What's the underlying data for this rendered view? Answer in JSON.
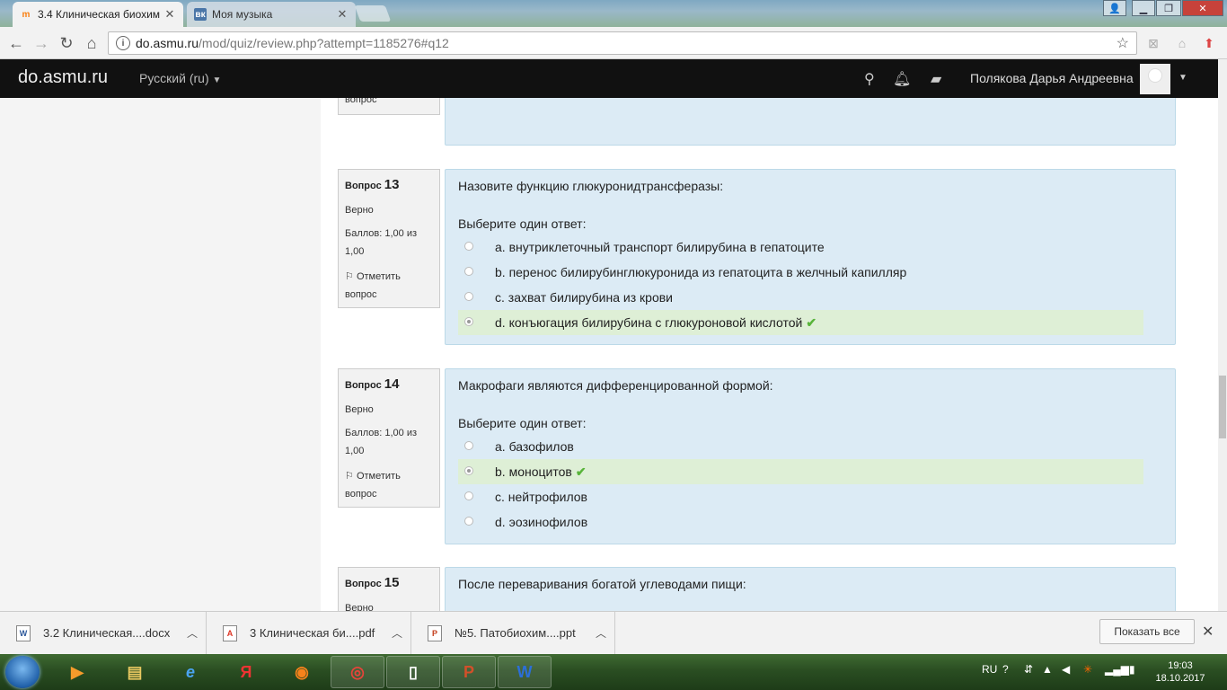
{
  "browser": {
    "tabs": [
      {
        "label": "3.4 Клиническая биохим",
        "active": true,
        "icon": "moodle-icon"
      },
      {
        "label": "Моя музыка",
        "active": false,
        "icon": "vk-icon"
      }
    ],
    "url_domain": "do.asmu.ru",
    "url_path": "/mod/quiz/review.php?attempt=1185276#q12"
  },
  "navbar": {
    "site_name": "do.asmu.ru",
    "language": "Русский (ru)",
    "user_name": "Полякова Дарья Андреевна"
  },
  "quiz": {
    "prev_block": {
      "flag_tail": "вопрос"
    },
    "questions": [
      {
        "label": "Вопрос",
        "number": "13",
        "state": "Верно",
        "grade": "Баллов: 1,00 из 1,00",
        "flag": "Отметить вопрос",
        "text": "Назовите функцию глюкуронидтрансферазы:",
        "prompt": "Выберите один ответ:",
        "options": [
          {
            "text": "a. внутриклеточный транспорт билирубина в гепатоците",
            "selected": false,
            "correct": false
          },
          {
            "text": "b. перенос билирубинглюкуронида из гепатоцита в желчный капилляр",
            "selected": false,
            "correct": false
          },
          {
            "text": "c. захват билирубина из крови",
            "selected": false,
            "correct": false
          },
          {
            "text": "d. конъюгация билирубина с глюкуроновой кислотой",
            "selected": true,
            "correct": true
          }
        ]
      },
      {
        "label": "Вопрос",
        "number": "14",
        "state": "Верно",
        "grade": "Баллов: 1,00 из 1,00",
        "flag": "Отметить вопрос",
        "text": "Макрофаги являются дифференцированной формой:",
        "prompt": "Выберите один ответ:",
        "options": [
          {
            "text": "a. базофилов",
            "selected": false,
            "correct": false
          },
          {
            "text": "b. моноцитов",
            "selected": true,
            "correct": true
          },
          {
            "text": "c. нейтрофилов",
            "selected": false,
            "correct": false
          },
          {
            "text": "d. эозинофилов",
            "selected": false,
            "correct": false
          }
        ]
      },
      {
        "label": "Вопрос",
        "number": "15",
        "state": "Верно",
        "text": "После переваривания богатой углеводами пищи:"
      }
    ]
  },
  "downloads": {
    "items": [
      {
        "name": "3.2 Клиническая....docx",
        "icon": "word-file-icon"
      },
      {
        "name": "3 Клиническая би....pdf",
        "icon": "pdf-file-icon"
      },
      {
        "name": "№5. Патобиохим....ppt",
        "icon": "ppt-file-icon"
      }
    ],
    "show_all": "Показать все"
  },
  "taskbar": {
    "language": "RU",
    "time": "19:03",
    "date": "18.10.2017"
  },
  "colors": {
    "question_bg": "#dcebf5",
    "correct_bg": "#deefd6",
    "navbar_bg": "#111111",
    "tick": "#58b43a"
  }
}
